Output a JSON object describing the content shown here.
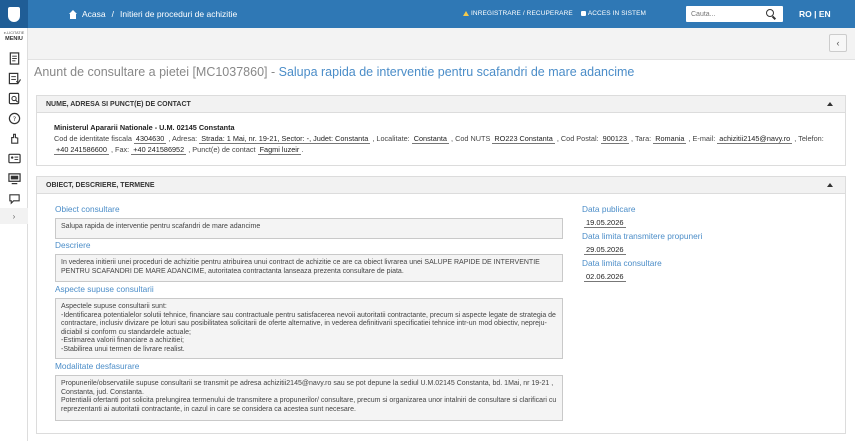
{
  "header": {
    "breadcrumb": [
      "Acasa",
      "Initieri de proceduri de achizitie"
    ],
    "links": [
      "INREGISTRARE / RECUPERARE",
      "ACCES IN SISTEM"
    ],
    "search_placeholder": "Cauta...",
    "lang_ro": "RO",
    "lang_sep": " | ",
    "lang_en": "EN"
  },
  "sidebar": {
    "menu_sub": "e-LICITATIE",
    "menu_title": "MENIU",
    "icons": [
      "document-icon",
      "list-check-icon",
      "gavel-icon",
      "help-icon",
      "hand-icon",
      "id-card-icon",
      "monitor-icon",
      "chat-icon"
    ],
    "chevron": "›"
  },
  "collapse_label": "‹",
  "page": {
    "title_prefix": "Anunt de consultare a pietei [MC1037860] - ",
    "title_accent": "Salupa rapida de interventie pentru scafandri de mare adancime"
  },
  "contact_panel": {
    "header": "NUME, ADRESA SI PUNCT(E) DE CONTACT",
    "name": "Ministerul Apararii Nationale - U.M. 02145 Constanta",
    "fiscal_label": "Cod de identitate fiscala",
    "fiscal_value": "4304630",
    "address_label": ", Adresa:",
    "address_value": "Strada: 1 Mai, nr. 19-21, Sector: -, Judet: Constanta",
    "locality_label": ", Localitate:",
    "locality_value": "Constanta",
    "nuts_label": ", Cod NUTS",
    "nuts_value": "RO223 Constanta",
    "postal_label": ", Cod Postal:",
    "postal_value": "900123",
    "country_label": ", Tara:",
    "country_value": "Romania",
    "email_label": ", E-mail:",
    "email_value": "achizitii2145@navy.ro",
    "phone_label": ", Telefon:",
    "phone_value": "+40 241586600",
    "fax_label": ", Fax:",
    "fax_value": "+40 241586952",
    "contact_label": ", Punct(e) de contact",
    "contact_value": "Fagmi luzeir",
    "tail": "."
  },
  "object_panel": {
    "header": "OBIECT, DESCRIERE, TERMENE",
    "obiect_label": "Obiect consultare",
    "obiect_value": "Salupa rapida de interventie pentru scafandri de mare adancime",
    "descriere_label": "Descriere",
    "descriere_value": "In vederea initierii unei proceduri de achizitie pentru atribuirea unui contract de achizitie ce are ca obiect livrarea unei SALUPE RAPIDE DE INTERVENTIE PENTRU SCAFANDRI DE MARE ADANCIME, autoritatea contractanta lanseaza prezenta consultare de piata.",
    "aspecte_label": "Aspecte supuse consultarii",
    "aspecte_value": "Aspectele supuse consultarii sunt:\n-Identificarea potentialelor solutii tehnice, financiare sau contractuale pentru satisfacerea nevoii autoritatii contractante, precum  si aspecte legate de strategia de contractare, inclusiv divizare pe loturi sau posibilitatea solicitarii de oferte alternative, in vederea definitivarii specificatiei tehnice intr-un mod obiectiv, nepreju­diciabil si conform cu standardele actuale;\n-Estimarea valorii financiare a achizitiei;\n-Stabilirea unui termen de livrare realist.",
    "modalitate_label": "Modalitate desfasurare",
    "modalitate_value": "Propunerile/observatiile supuse consultarii se transmit pe adresa achizitii2145@navy.ro sau se pot depune la sediul U.M.02145 Constanta, bd. 1Mai, nr 19-21 , Constanta, jud. Constanta.\nPotentialii ofertanti pot solicita prelungirea termenului de transmitere a propunerilor/ consultare, precum si organizarea unor intalniri de consultare si clarificari cu reprezentanti ai autoritatii contractante, in cazul in care se considera ca acestea sunt necesare.",
    "data_publicare_label": "Data publicare",
    "data_publicare": "19.05.2026",
    "data_transmitere_label": "Data limita transmitere propuneri",
    "data_transmitere": "29.05.2026",
    "data_consultare_label": "Data limita consultare",
    "data_consultare": "02.06.2026"
  },
  "colors": {
    "topbar": "#2f78b5",
    "accent": "#4b8dc8"
  }
}
